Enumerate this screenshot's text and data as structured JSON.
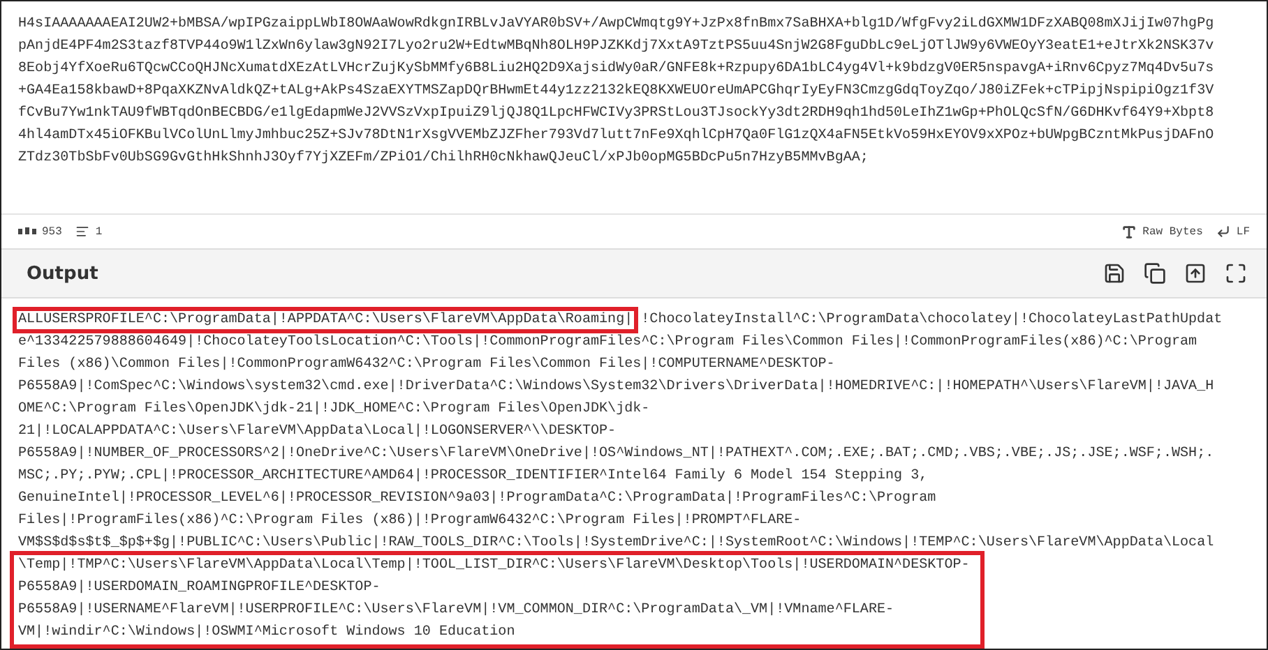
{
  "input": {
    "lines": [
      "H4sIAAAAAAAEAI2UW2+bMBSA/wpIPGzaippLWbI8OWAaWowRdkgnIRBLvJaVYAR0bSV+/AwpCWmqtg9Y+JzPx8fnBmx7SaBHXA+blg1D/WfgFvy2iLdGXMW1DFzXABQ08mXJijIw07hgPg",
      "pAnjdE4PF4m2S3tazf8TVP44o9W1lZxWn6ylaw3gN92I7Lyo2ru2W+EdtwMBqNh8OLH9PJZKKdj7XxtA9TztPS5uu4SnjW2G8FguDbLc9eLjOTlJW9y6VWEOyY3eatE1+eJtrXk2NSK37v",
      "8Eobj4YfXoeRu6TQcwCCoQHJNcXumatdXEzAtLVHcrZujKySbMMfy6B8Liu2HQ2D9XajsidWy0aR/GNFE8k+Rzpupy6DA1bLC4yg4Vl+k9bdzgV0ER5nspavgA+iRnv6Cpyz7Mq4Dv5u7s",
      "+GA4Ea158kbawD+8PqaXKZNvAldkQZ+tALg+AkPs4SzaEXYTMSZapDQrBHwmEt44y1zz2132kEQ8KXWEUOreUmAPCGhqrIyEyFN3CmzgGdqToyZqo/J80iZFek+cTPipjNspipiOgz1f3V",
      "fCvBu7Yw1nkTAU9fWBTqdOnBECBDG/e1lgEdapmWeJ2VVSzVxpIpuiZ9ljQJ8Q1LpcHFWCIVy3PRStLou3TJsockYy3dt2RDH9qh1hd50LeIhZ1wGp+PhOLQcSfN/G6DHKvf64Y9+Xbpt8",
      "4hl4amDTx45iOFKBulVColUnLlmyJmhbuc25Z+SJv78DtN1rXsgVVEMbZJZFher793Vd7lutt7nFe9XqhlCpH7Qa0FlG1zQX4aFN5EtkVo59HxEYOV9xXPOz+bUWpgBCzntMkPusjDAFnO",
      "ZTdz30TbSbFv0UbSG9GvGthHkShnhJ3Oyf7YjXZEFm/ZPiO1/ChilhRH0cNkhawQJeuCl/xPJb0opMG5BDcPu5n7HzyB5MMvBgAA;"
    ]
  },
  "status_bar": {
    "length": "953",
    "line_count": "1",
    "encoding": "Raw Bytes",
    "line_ending": "LF"
  },
  "output": {
    "title": "Output",
    "lines": [
      {
        "segments": [
          {
            "text": "ALLUSERSPROFILE^C:\\ProgramData|!APPDATA^C:\\Users\\FlareVM\\AppData\\Roaming|",
            "highlighted": true
          },
          {
            "text": "!ChocolateyInstall^C:\\ProgramData\\chocolatey|!ChocolateyLastPathUpdat",
            "highlighted": false
          }
        ]
      },
      {
        "segments": [
          {
            "text": "e^133422579888604649|!ChocolateyToolsLocation^C:\\Tools|!CommonProgramFiles^C:\\Program Files\\Common Files|!CommonProgramFiles(x86)^C:\\Program",
            "highlighted": false
          }
        ]
      },
      {
        "segments": [
          {
            "text": "Files (x86)\\Common Files|!CommonProgramW6432^C:\\Program Files\\Common Files|!COMPUTERNAME^DESKTOP-",
            "highlighted": false
          }
        ]
      },
      {
        "segments": [
          {
            "text": "P6558A9|!ComSpec^C:\\Windows\\system32\\cmd.exe|!DriverData^C:\\Windows\\System32\\Drivers\\DriverData|!HOMEDRIVE^C:|!HOMEPATH^\\Users\\FlareVM|!JAVA_H",
            "highlighted": false
          }
        ]
      },
      {
        "segments": [
          {
            "text": "OME^C:\\Program Files\\OpenJDK\\jdk-21|!JDK_HOME^C:\\Program Files\\OpenJDK\\jdk-",
            "highlighted": false
          }
        ]
      },
      {
        "segments": [
          {
            "text": "21|!LOCALAPPDATA^C:\\Users\\FlareVM\\AppData\\Local|!LOGONSERVER^\\\\DESKTOP-",
            "highlighted": false
          }
        ]
      },
      {
        "segments": [
          {
            "text": "P6558A9|!NUMBER_OF_PROCESSORS^2|!OneDrive^C:\\Users\\FlareVM\\OneDrive|!OS^Windows_NT|!PATHEXT^.COM;.EXE;.BAT;.CMD;.VBS;.VBE;.JS;.JSE;.WSF;.WSH;.",
            "highlighted": false
          }
        ]
      },
      {
        "segments": [
          {
            "text": "MSC;.PY;.PYW;.CPL|!PROCESSOR_ARCHITECTURE^AMD64|!PROCESSOR_IDENTIFIER^Intel64 Family 6 Model 154 Stepping 3,",
            "highlighted": false
          }
        ]
      },
      {
        "segments": [
          {
            "text": "GenuineIntel|!PROCESSOR_LEVEL^6|!PROCESSOR_REVISION^9a03|!ProgramData^C:\\ProgramData|!ProgramFiles^C:\\Program",
            "highlighted": false
          }
        ]
      },
      {
        "segments": [
          {
            "text": "Files|!ProgramFiles(x86)^C:\\Program Files (x86)|!ProgramW6432^C:\\Program Files|!PROMPT^FLARE-",
            "highlighted": false
          }
        ]
      },
      {
        "segments": [
          {
            "text": "VM$S$d$s$t$_$p$+$g|!PUBLIC^C:\\Users\\Public|!RAW_TOOLS_DIR^C:\\Tools|!SystemDrive^C:|!SystemRoot^C:\\Windows|!TEMP^C:\\Users\\FlareVM\\AppData\\Local",
            "highlighted": false
          }
        ]
      },
      {
        "segments": [
          {
            "text": "\\Temp|!TMP^C:\\Users\\FlareVM\\AppData\\Local\\Temp|!TOOL_LIST_DIR^C:\\Users\\FlareVM\\Desktop\\Tools|!USERDOMAIN^DESKTOP-",
            "highlighted": true
          }
        ]
      },
      {
        "segments": [
          {
            "text": "P6558A9|!USERDOMAIN_ROAMINGPROFILE^DESKTOP-",
            "highlighted": true
          }
        ]
      },
      {
        "segments": [
          {
            "text": "P6558A9|!USERNAME^FlareVM|!USERPROFILE^C:\\Users\\FlareVM|!VM_COMMON_DIR^C:\\ProgramData\\_VM|!VMname^FLARE-",
            "highlighted": true
          }
        ]
      },
      {
        "segments": [
          {
            "text": "VM|!windir^C:\\Windows|!OSWMI^Microsoft Windows 10 Education",
            "highlighted": true
          }
        ]
      }
    ]
  }
}
